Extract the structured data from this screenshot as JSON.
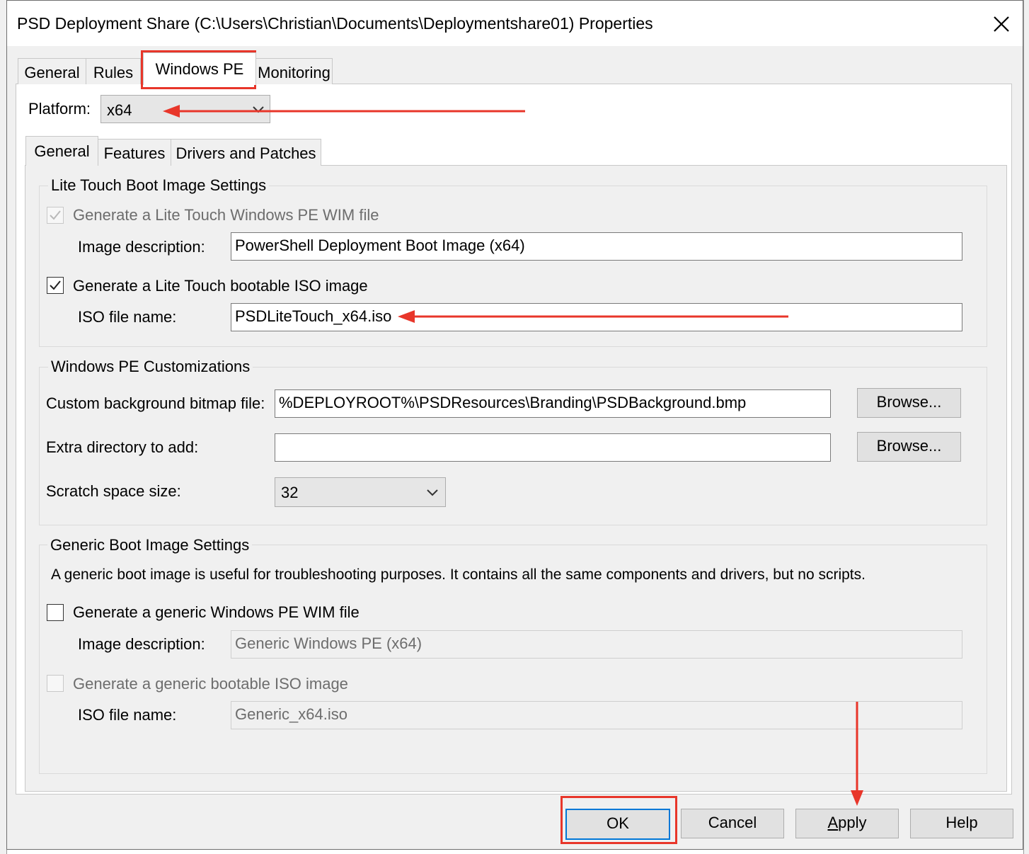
{
  "dialog": {
    "title": "PSD Deployment Share (C:\\Users\\Christian\\Documents\\Deploymentshare01) Properties"
  },
  "tabs": [
    {
      "label": "General"
    },
    {
      "label": "Rules"
    },
    {
      "label": "Windows PE",
      "selected": true
    },
    {
      "label": "Monitoring"
    }
  ],
  "platform": {
    "label": "Platform:",
    "value": "x64"
  },
  "subtabs": [
    {
      "label": "General",
      "selected": true
    },
    {
      "label": "Features"
    },
    {
      "label": "Drivers and Patches"
    }
  ],
  "lite_touch": {
    "legend": "Lite Touch Boot Image Settings",
    "generate_wim": {
      "label": "Generate a Lite Touch Windows PE WIM file",
      "checked": true,
      "enabled": false
    },
    "image_description": {
      "label": "Image description:",
      "value": "PowerShell Deployment Boot Image (x64)"
    },
    "generate_iso": {
      "label": "Generate a Lite Touch bootable ISO image",
      "checked": true,
      "enabled": true
    },
    "iso_file_name": {
      "label": "ISO file name:",
      "value": "PSDLiteTouch_x64.iso"
    }
  },
  "customizations": {
    "legend": "Windows PE Customizations",
    "background_bitmap": {
      "label": "Custom background bitmap file:",
      "value": "%DEPLOYROOT%\\PSDResources\\Branding\\PSDBackground.bmp",
      "browse_label": "Browse..."
    },
    "extra_directory": {
      "label": "Extra directory to add:",
      "value": "",
      "browse_label": "Browse..."
    },
    "scratch_space": {
      "label": "Scratch space size:",
      "value": "32"
    }
  },
  "generic": {
    "legend": "Generic Boot Image Settings",
    "description": "A generic boot image is useful for troubleshooting purposes.  It contains all the same components and drivers, but no scripts.",
    "generate_wim": {
      "label": "Generate a generic Windows PE WIM file",
      "checked": false,
      "enabled": true
    },
    "image_description": {
      "label": "Image description:",
      "value": "Generic Windows PE (x64)"
    },
    "generate_iso": {
      "label": "Generate a generic bootable ISO image",
      "checked": false,
      "enabled": false
    },
    "iso_file_name": {
      "label": "ISO file name:",
      "value": "Generic_x64.iso"
    }
  },
  "buttons": {
    "ok": "OK",
    "cancel": "Cancel",
    "apply_prefix": "",
    "apply_mnemonic": "A",
    "apply_rest": "pply",
    "help": "Help"
  },
  "annotation_color": "#e8362a"
}
